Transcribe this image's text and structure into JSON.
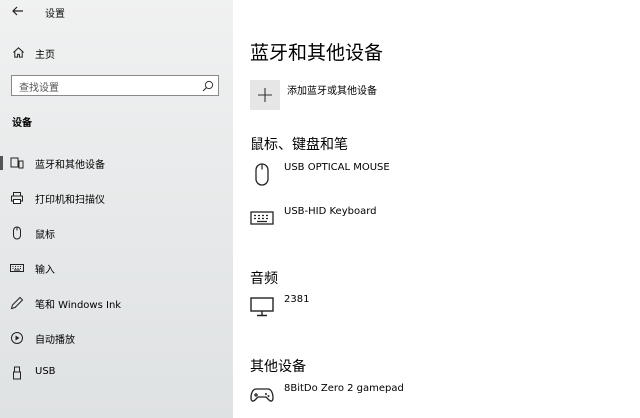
{
  "window": {
    "app_title": "设置"
  },
  "sidebar": {
    "home_label": "主页",
    "search_placeholder": "查找设置",
    "section_title": "设备",
    "items": [
      {
        "label": "蓝牙和其他设备",
        "icon": "bluetooth-devices-icon",
        "selected": true
      },
      {
        "label": "打印机和扫描仪",
        "icon": "printer-icon",
        "selected": false
      },
      {
        "label": "鼠标",
        "icon": "mouse-icon",
        "selected": false
      },
      {
        "label": "输入",
        "icon": "keyboard-icon",
        "selected": false
      },
      {
        "label": "笔和 Windows Ink",
        "icon": "pen-icon",
        "selected": false
      },
      {
        "label": "自动播放",
        "icon": "autoplay-icon",
        "selected": false
      },
      {
        "label": "USB",
        "icon": "usb-icon",
        "selected": false
      }
    ]
  },
  "main": {
    "title": "蓝牙和其他设备",
    "add_label": "添加蓝牙或其他设备",
    "groups": [
      {
        "title": "鼠标、键盘和笔",
        "devices": [
          {
            "name": "USB OPTICAL MOUSE",
            "icon": "mouse-icon"
          },
          {
            "name": "USB-HID Keyboard",
            "icon": "keyboard-icon"
          }
        ]
      },
      {
        "title": "音频",
        "devices": [
          {
            "name": "2381",
            "icon": "monitor-icon"
          }
        ]
      },
      {
        "title": "其他设备",
        "devices": [
          {
            "name": "8BitDo Zero 2 gamepad",
            "icon": "gamepad-icon"
          }
        ]
      }
    ]
  }
}
